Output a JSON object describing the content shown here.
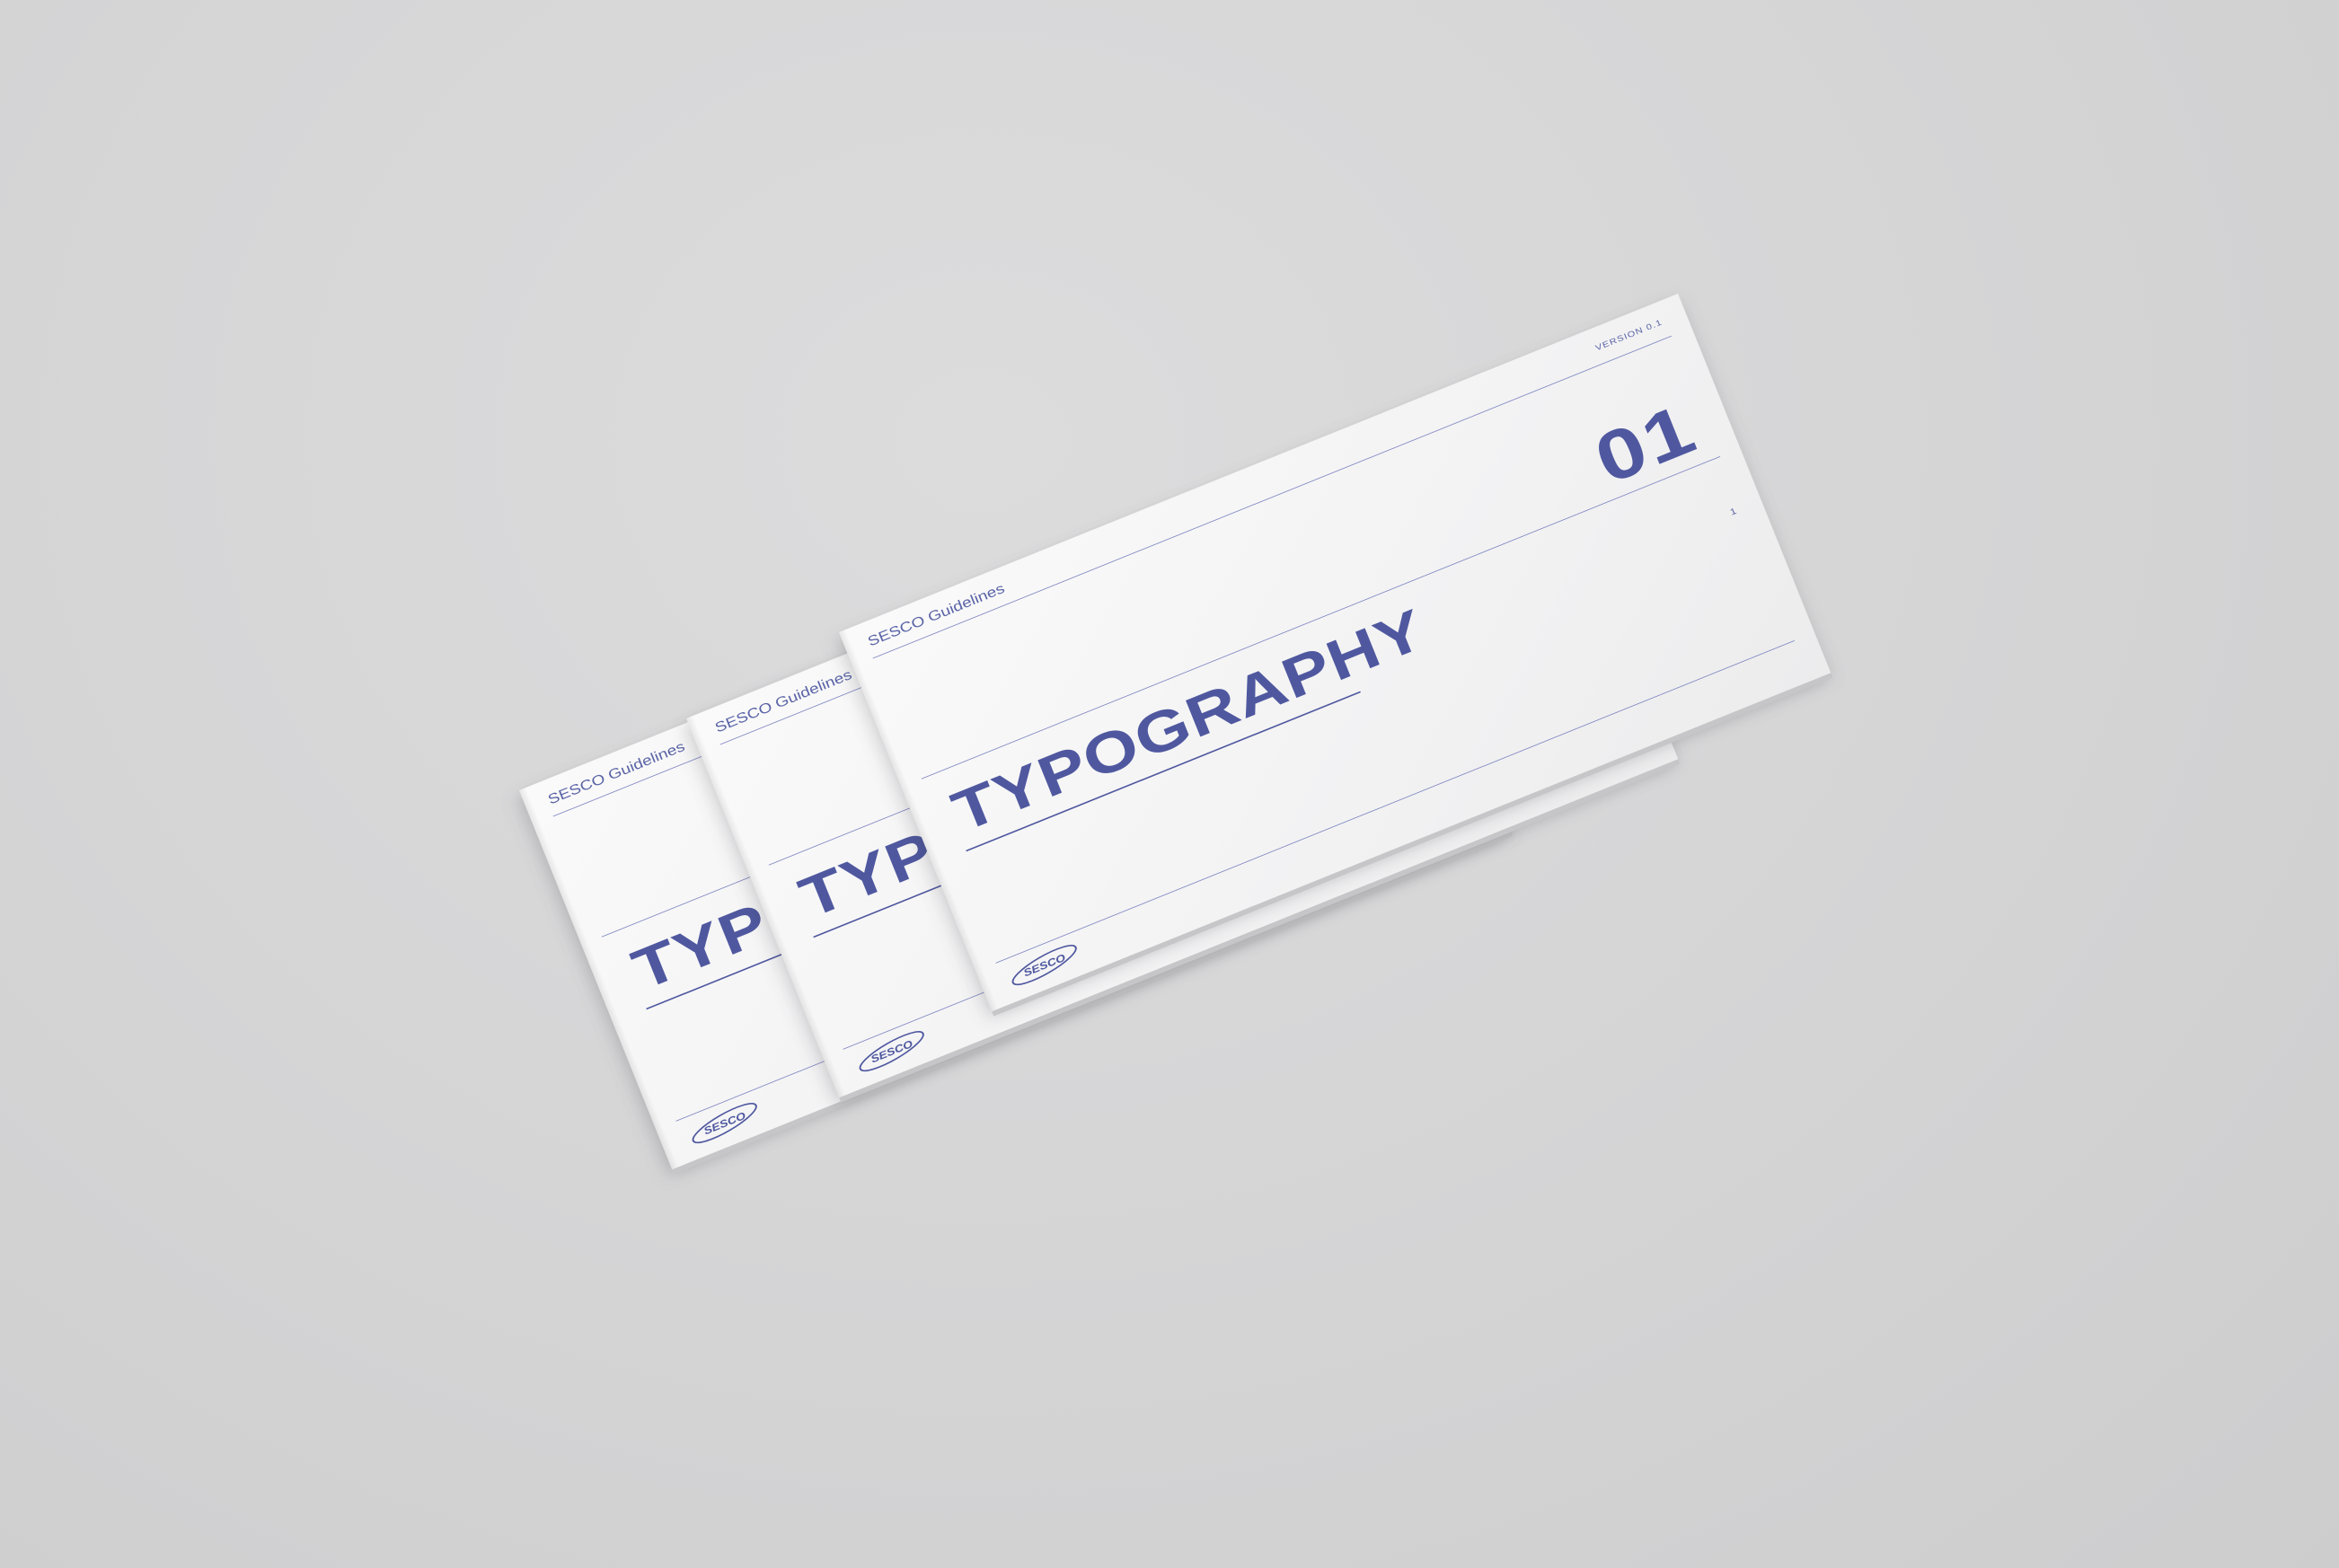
{
  "colors": {
    "background": "#d6d6d7",
    "paper": "#f4f4f5",
    "ink": "#4f589f"
  },
  "booklets": [
    {
      "brand": "SESCO Guidelines",
      "version": "",
      "number": "",
      "title": "TYPOGRAPHY",
      "page_number": "",
      "logo_text": "SESCO"
    },
    {
      "brand": "SESCO Guidelines",
      "version": "",
      "number": "",
      "title": "TYPOGRAPHY",
      "page_number": "",
      "logo_text": "SESCO"
    },
    {
      "brand": "SESCO Guidelines",
      "version": "VERSION 0.1",
      "number": "01",
      "title": "TYPOGRAPHY",
      "page_number": "1",
      "logo_text": "SESCO"
    }
  ]
}
